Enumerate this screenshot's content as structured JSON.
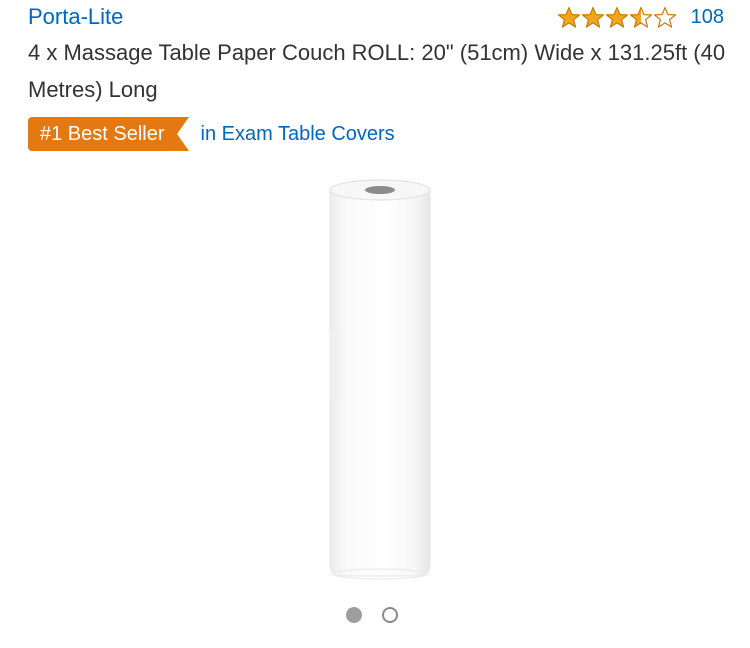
{
  "product": {
    "brand": "Porta-Lite",
    "rating": {
      "value": 3.5,
      "max": 5,
      "count": "108",
      "star_color": "#f0a620",
      "star_outline": "#c77d0b"
    },
    "title": "4 x Massage Table Paper Couch ROLL: 20\" (51cm) Wide x 131.25ft (40 Metres) Long",
    "badge": {
      "label": "#1 Best Seller",
      "color": "#e47911"
    },
    "category_link": "in Exam Table Covers"
  },
  "carousel": {
    "total": 2,
    "active_index": 0
  },
  "colors": {
    "link": "#0066c0",
    "text": "#333333"
  }
}
